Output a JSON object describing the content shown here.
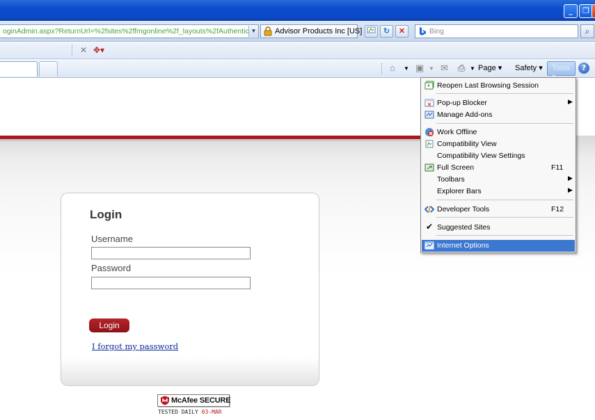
{
  "browser": {
    "address_url": "oginAdmin.aspx?ReturnUrl=%2fsites%2ffmgonline%2f_layouts%2fAuthentica",
    "cert_name": "Advisor Products Inc [US]",
    "search_placeholder": "Bing",
    "command_bar": {
      "page_label": "Page",
      "safety_label": "Safety",
      "tools_label": "Tools"
    }
  },
  "tools_menu": {
    "items": [
      {
        "label": "Reopen Last Browsing Session",
        "shortcut": "",
        "submenu": false
      },
      {
        "label": "Pop-up Blocker",
        "shortcut": "",
        "submenu": true
      },
      {
        "label": "Manage Add-ons",
        "shortcut": "",
        "submenu": false
      },
      {
        "label": "Work Offline",
        "shortcut": "",
        "submenu": false
      },
      {
        "label": "Compatibility View",
        "shortcut": "",
        "submenu": false
      },
      {
        "label": "Compatibility View Settings",
        "shortcut": "",
        "submenu": false
      },
      {
        "label": "Full Screen",
        "shortcut": "F11",
        "submenu": false
      },
      {
        "label": "Toolbars",
        "shortcut": "",
        "submenu": true
      },
      {
        "label": "Explorer Bars",
        "shortcut": "",
        "submenu": true
      },
      {
        "label": "Developer Tools",
        "shortcut": "F12",
        "submenu": false
      },
      {
        "label": "Suggested Sites",
        "shortcut": "",
        "submenu": false
      },
      {
        "label": "Internet Options",
        "shortcut": "",
        "submenu": false
      }
    ],
    "highlighted_item": "Internet Options"
  },
  "login": {
    "title": "Login",
    "username_label": "Username",
    "username_value": "",
    "password_label": "Password",
    "password_value": "",
    "submit_label": "Login",
    "forgot_link": "I forgot my password"
  },
  "badge": {
    "brand": "McAfee SECURE",
    "tested_text": "TESTED DAILY",
    "date_text": "03-MAR"
  },
  "colors": {
    "titlebar_blue": "#0a4ecf",
    "brand_red": "#a8171c",
    "menu_highlight": "#3c78d0",
    "link_blue": "#0b2a9c"
  }
}
